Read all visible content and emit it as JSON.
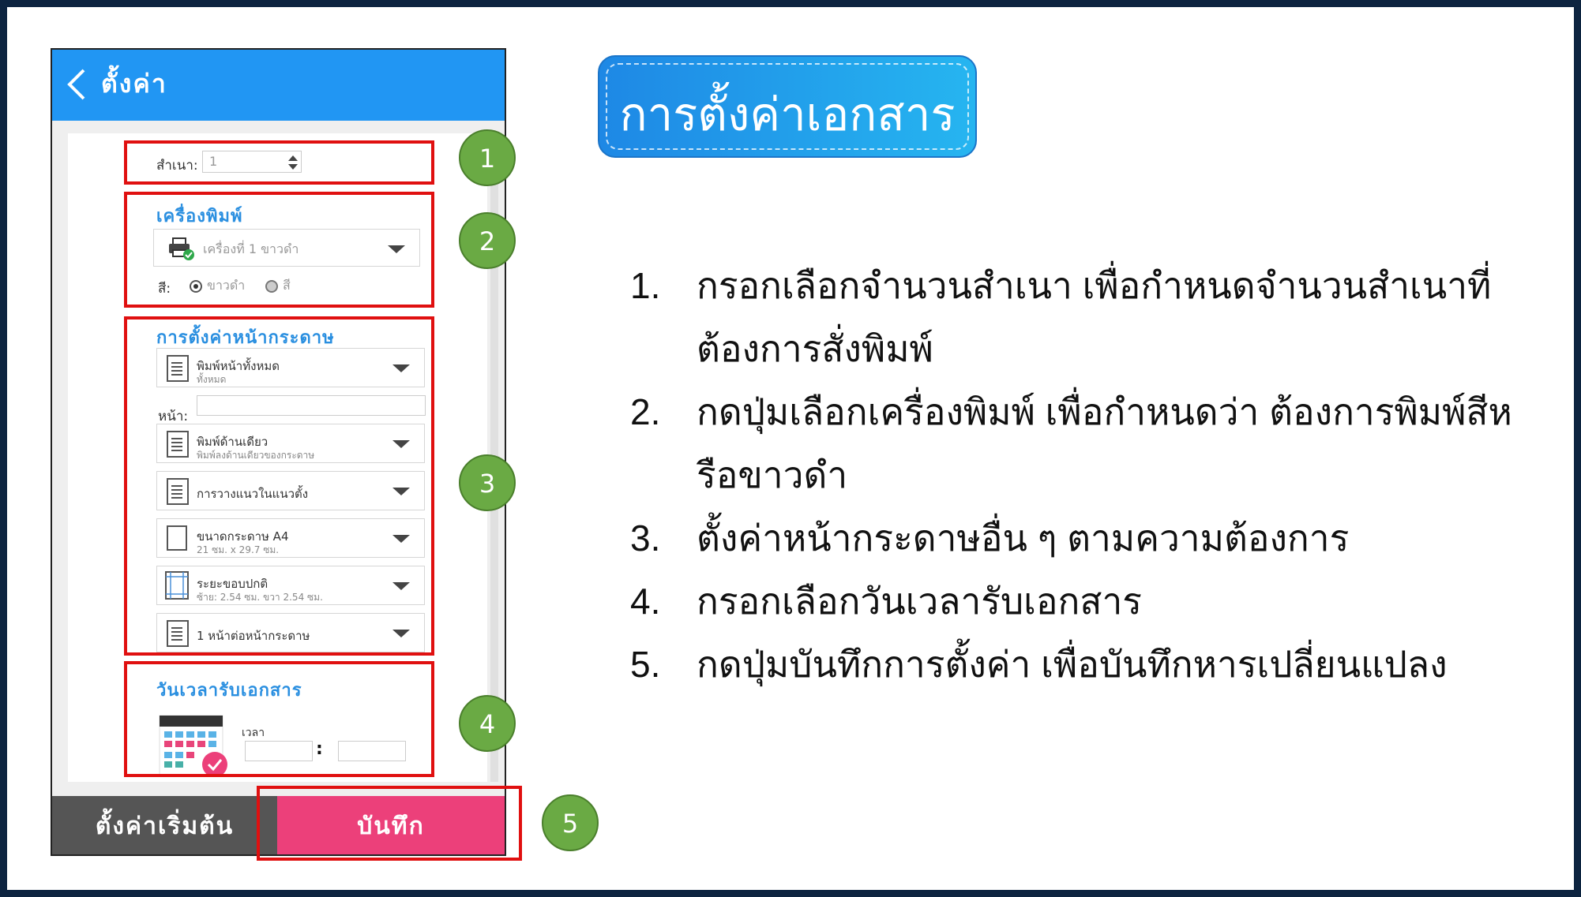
{
  "app": {
    "back_label": "ตั้งค่า"
  },
  "copies": {
    "label": "สำเนา:",
    "value": "1"
  },
  "printer": {
    "heading": "เครื่องพิมพ์",
    "selected": "เครื่องที่ 1  ขาวดำ",
    "color_label": "สี:",
    "options": [
      "ขาวดำ",
      "สี"
    ]
  },
  "page_setup": {
    "heading": "การตั้งค่าหน้ากระดาษ",
    "pages_label": "หน้า:",
    "items": [
      {
        "title": "พิมพ์หน้าทั้งหมด",
        "subtitle": "ทั้งหมด"
      },
      {
        "title": "พิมพ์ด้านเดียว",
        "subtitle": "พิมพ์ลงด้านเดียวของกระดาษ"
      },
      {
        "title": "การวางแนวในแนวตั้ง",
        "subtitle": ""
      },
      {
        "title": "ขนาดกระดาษ  A4",
        "subtitle": "21 ซม. x 29.7 ซม."
      },
      {
        "title": "ระยะขอบปกติ",
        "subtitle": "ซ้าย: 2.54 ซม.     ขวา 2.54 ซม."
      },
      {
        "title": "1 หน้าต่อหน้ากระดาษ",
        "subtitle": ""
      }
    ]
  },
  "pickup": {
    "heading": "วันเวลารับเอกสาร",
    "time_label": "เวลา",
    "time_sep": ":"
  },
  "buttons": {
    "reset": "ตั้งค่าเริ่มต้น",
    "save": "บันทึก"
  },
  "markers": [
    "1",
    "2",
    "3",
    "4",
    "5"
  ],
  "banner_title": "การตั้งค่าเอกสาร",
  "instructions": [
    {
      "num": "1.",
      "text": "กรอกเลือกจำนวนสำเนา เพื่อกำหนดจำนวนสำเนาที่ต้องการสั่งพิมพ์"
    },
    {
      "num": "2.",
      "text": "กดปุ่มเลือกเครื่องพิมพ์ เพื่อกำหนดว่า ต้องการพิมพ์สีหรือขาวดำ"
    },
    {
      "num": "3.",
      "text": "ตั้งค่าหน้ากระดาษอื่น ๆ ตามความต้องการ"
    },
    {
      "num": "4.",
      "text": "กรอกเลือกวันเวลารับเอกสาร"
    },
    {
      "num": "5.",
      "text": "กดปุ่มบันทึกการตั้งค่า เพื่อบันทึกหารเปลี่ยนแปลง"
    }
  ],
  "colors": {
    "topbar": "#2196f3",
    "save": "#ec407a",
    "reset": "#555555",
    "marker": "#6aaa44",
    "highlight": "#e01010"
  }
}
